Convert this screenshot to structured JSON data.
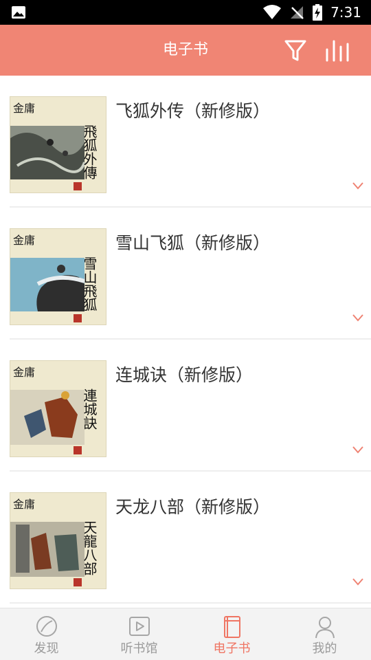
{
  "status_bar": {
    "time": "7:31"
  },
  "app_bar": {
    "title": "电子书",
    "filter_icon": "filter-icon",
    "stats_icon": "bar-chart-icon"
  },
  "books": [
    {
      "title": "飞狐外传（新修版）",
      "cover": {
        "brand": "金庸",
        "name": "飛狐外傳"
      }
    },
    {
      "title": "雪山飞狐（新修版）",
      "cover": {
        "brand": "金庸",
        "name": "雪山飛狐"
      }
    },
    {
      "title": "连城诀（新修版）",
      "cover": {
        "brand": "金庸",
        "name": "連城訣"
      }
    },
    {
      "title": "天龙八部（新修版）",
      "cover": {
        "brand": "金庸",
        "name": "天龍八部"
      }
    }
  ],
  "tabs": [
    {
      "label": "发现",
      "icon": "compass-icon",
      "active": false
    },
    {
      "label": "听书馆",
      "icon": "play-icon",
      "active": false
    },
    {
      "label": "电子书",
      "icon": "book-icon",
      "active": true
    },
    {
      "label": "我的",
      "icon": "person-icon",
      "active": false
    }
  ],
  "colors": {
    "accent": "#f08574",
    "active_tab": "#ef7563",
    "inactive_tab": "#9a9a9a"
  }
}
